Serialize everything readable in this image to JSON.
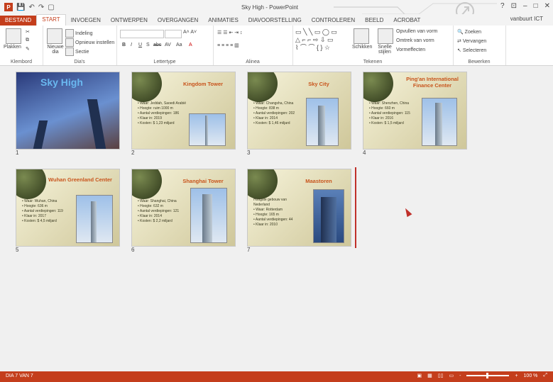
{
  "window": {
    "title": "Sky High - PowerPoint",
    "user": "vanbuurt ICT",
    "controls": [
      "?",
      "⊡",
      "–",
      "□",
      "✕"
    ]
  },
  "qat": [
    "💾",
    "↶",
    "↷",
    "▢"
  ],
  "tabs": [
    "BESTAND",
    "START",
    "INVOEGEN",
    "ONTWERPEN",
    "OVERGANGEN",
    "ANIMATIES",
    "DIAVOORSTELLING",
    "CONTROLEREN",
    "BEELD",
    "ACROBAT"
  ],
  "ribbon": {
    "clipboard": {
      "paste": "Plakken",
      "label": "Klembord"
    },
    "slides": {
      "new": "Nieuwe dia",
      "layout": "Indeling",
      "reset": "Opnieuw instellen",
      "section": "Sectie",
      "label": "Dia's"
    },
    "font": {
      "b": "B",
      "i": "I",
      "u": "U",
      "s": "S",
      "abc": "abc",
      "av": "AV",
      "aa": "Aa",
      "a": "A",
      "label": "Lettertype"
    },
    "paragraph": {
      "label": "Alinea"
    },
    "drawing": {
      "arrange": "Schikken",
      "quick": "Snelle stijlen",
      "fill": "Opvullen van vorm",
      "outline": "Omtrek van vorm",
      "effects": "Vormeffecten",
      "label": "Tekenen"
    },
    "editing": {
      "find": "Zoeken",
      "replace": "Vervangen",
      "select": "Selecteren",
      "label": "Bewerken"
    }
  },
  "slides": [
    {
      "num": "1",
      "title": "Sky High"
    },
    {
      "num": "2",
      "title": "Kingdom Tower",
      "bullets": [
        "• Waar: Jeddah, Saoedi Arabië",
        "• Hoogte: ruim 1000 m",
        "• Aantal verdiepingen: 186",
        "• Klaar in: 2019",
        "• Kosten: $ 1,23 miljard"
      ]
    },
    {
      "num": "3",
      "title": "Sky City",
      "bullets": [
        "• Waar: Changsha, China",
        "• Hoogte: 838 m",
        "• Aantal verdiepingen: 202",
        "• Klaar in: 2014",
        "• Kosten: $ 1,46 miljard"
      ]
    },
    {
      "num": "4",
      "title": "Ping'an International Finance Center",
      "bullets": [
        "• Waar: Shenzhen, China",
        "• Hoogte: 660 m",
        "• Aantal verdiepingen: 115",
        "• Klaar in: 2016",
        "• Kosten: $ 1,5 miljard"
      ]
    },
    {
      "num": "5",
      "title": "Wuhan Greenland Center",
      "bullets": [
        "• Waar: Wuhan, China",
        "• Hoogte: 636 m",
        "• Aantal verdiepingen: 119",
        "• Klaar in: 2017",
        "• Kosten: $ 4,5 miljard"
      ]
    },
    {
      "num": "6",
      "title": "Shanghai Tower",
      "bullets": [
        "• Waar: Shanghai, China",
        "• Hoogte: 632 m",
        "• Aantal verdiepingen: 121",
        "• Klaar in: 2014",
        "• Kosten: $ 2,2 miljard"
      ]
    },
    {
      "num": "7",
      "title": "Maastoren",
      "bullets": [
        "Hoogste gebouw van Nederland",
        "• Waar: Rotterdam",
        "• Hoogte: 165 m",
        "• Aantal verdiepingen: 44",
        "• Klaar in: 2010"
      ]
    }
  ],
  "status": {
    "slide": "DIA 7 VAN 7",
    "zoom": "100 %",
    "plus": "+",
    "minus": "-"
  },
  "colors": {
    "accent": "#c43e1c",
    "slide_title": "#c8541c"
  }
}
